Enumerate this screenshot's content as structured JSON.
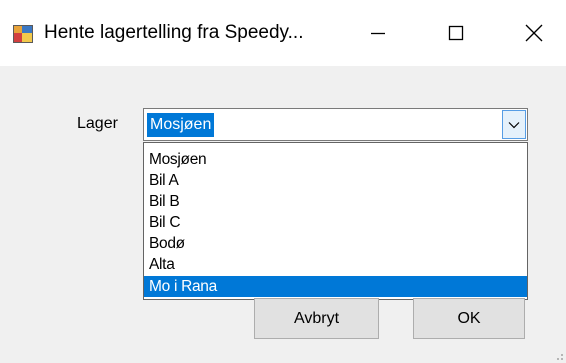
{
  "window": {
    "title": "Hente lagertelling fra Speedy...",
    "icons": {
      "app": "app-icon",
      "minimize": "minimize-icon",
      "maximize": "maximize-icon",
      "close": "close-icon"
    }
  },
  "form": {
    "lager_label": "Lager",
    "combo_value": "Mosjøen",
    "options": [
      "Mosjøen",
      "Bil A",
      "Bil B",
      "Bil C",
      "Bodø",
      "Alta",
      "Mo i Rana"
    ],
    "highlighted_option": "Mo i Rana"
  },
  "buttons": {
    "cancel_label": "Avbryt",
    "ok_label": "OK"
  },
  "colors": {
    "selection": "#0078d7",
    "window_bg": "#f0f0f0",
    "button_bg": "#e1e1e1"
  }
}
